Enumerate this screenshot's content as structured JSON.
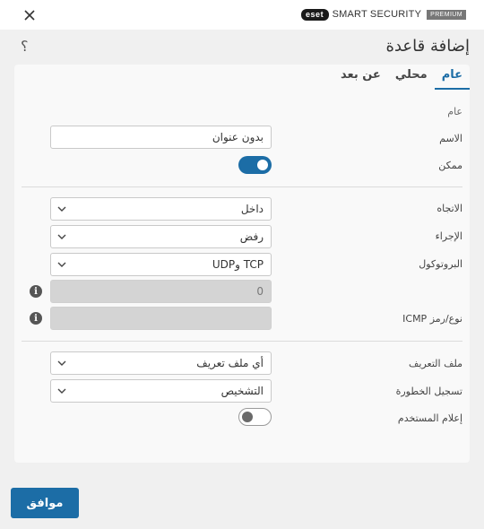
{
  "brand": {
    "logo": "eset",
    "name": "SMART SECURITY",
    "badge": "PREMIUM"
  },
  "header": {
    "title": "إضافة قاعدة",
    "help": "؟"
  },
  "tabs": [
    {
      "label": "عام",
      "active": true
    },
    {
      "label": "محلي",
      "active": false
    },
    {
      "label": "عن بعد",
      "active": false
    }
  ],
  "general": {
    "section_label": "عام",
    "name_label": "الاسم",
    "name_value": "بدون عنوان",
    "enabled_label": "ممكن",
    "enabled": true
  },
  "rule": {
    "direction_label": "الاتجاه",
    "direction_value": "داخل",
    "action_label": "الإجراء",
    "action_value": "رفض",
    "protocol_label": "البروتوكول",
    "protocol_value": "TCP وUDP",
    "protocol_number_value": "0",
    "icmp_label": "نوع/رمز ICMP",
    "icmp_value": ""
  },
  "logging": {
    "profile_label": "ملف التعريف",
    "profile_value": "أي ملف تعريف",
    "severity_label": "تسجيل الخطورة",
    "severity_value": "التشخيص",
    "notify_label": "إعلام المستخدم",
    "notify": false
  },
  "footer": {
    "ok_label": "موافق"
  },
  "colors": {
    "accent": "#1c6da6",
    "background": "#f0f0f0",
    "card": "#f9f9f9"
  }
}
